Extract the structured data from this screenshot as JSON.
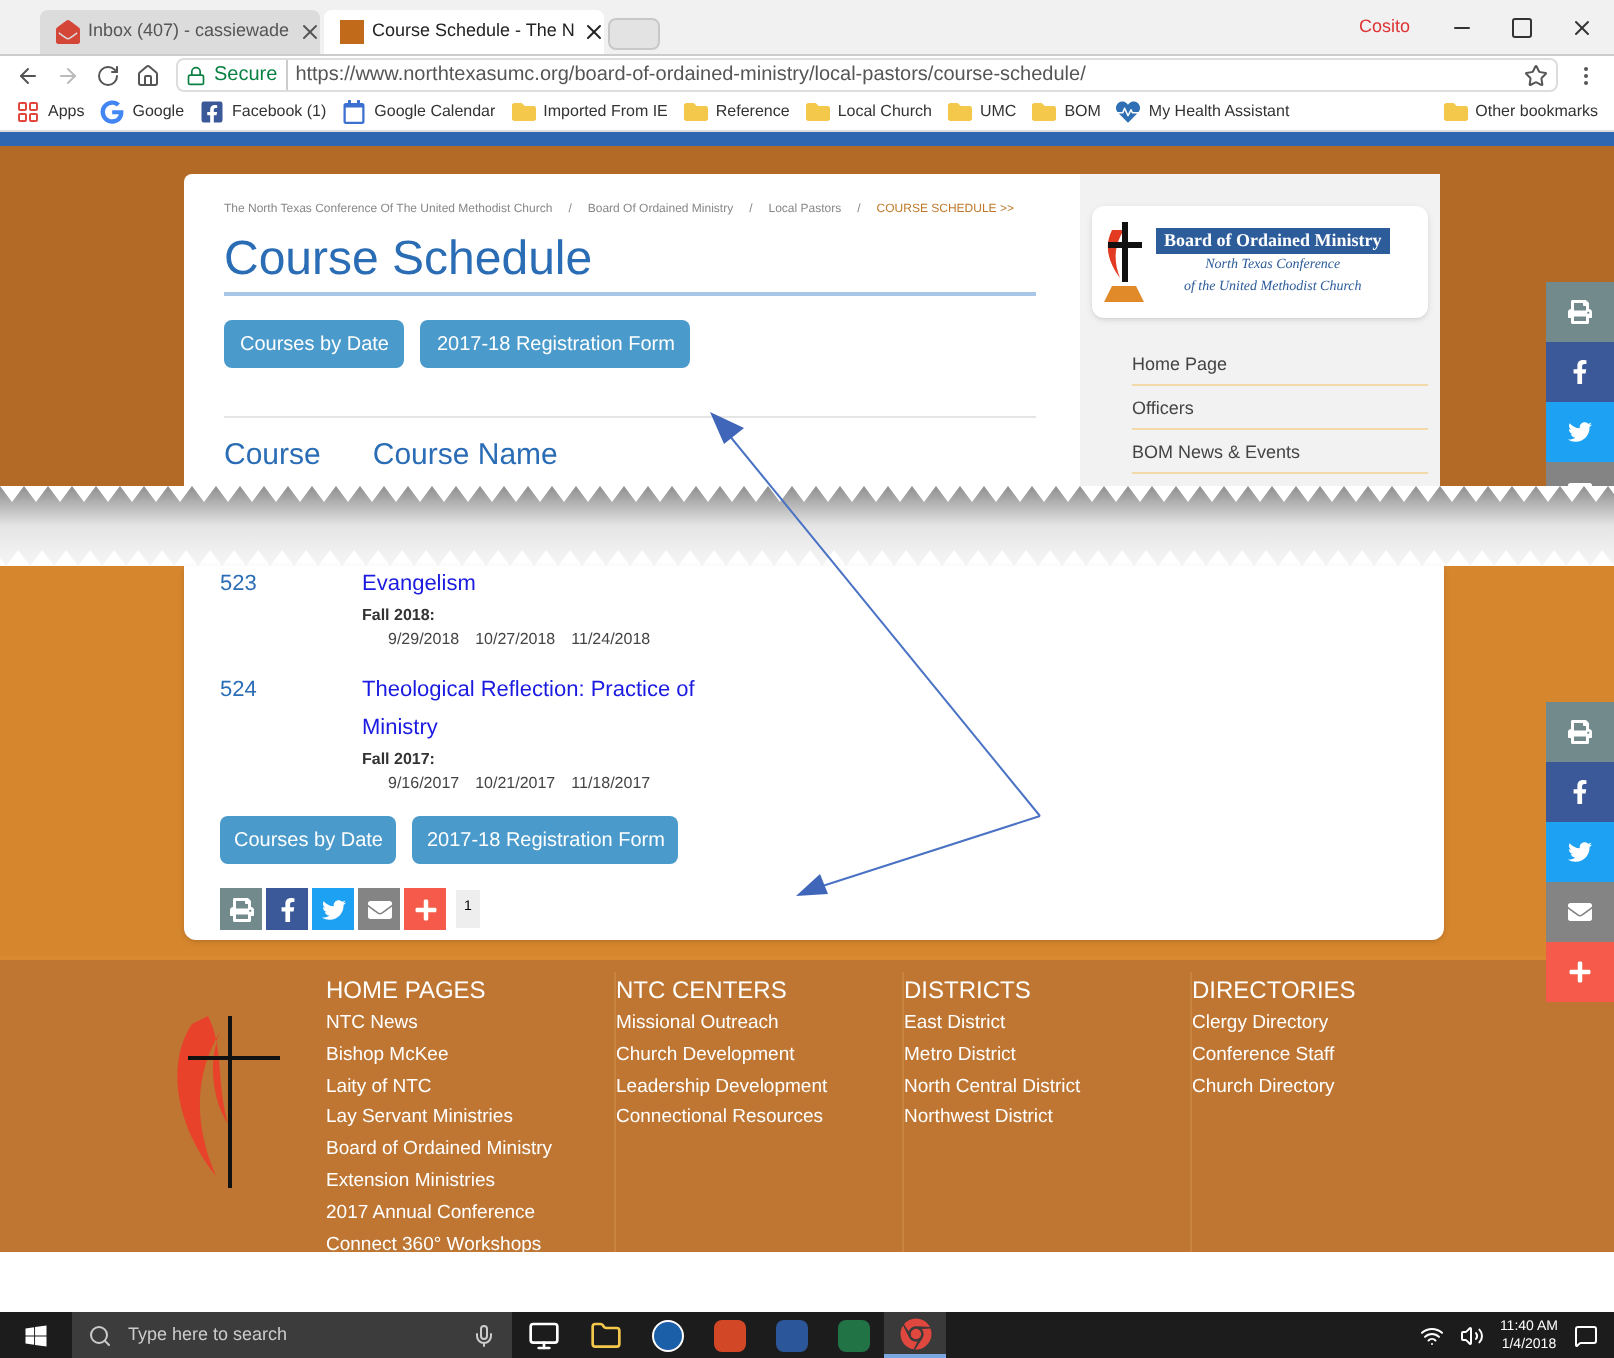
{
  "browser": {
    "tabs": [
      {
        "title": "Inbox (407) - cassiewade",
        "kind": "mail",
        "selected": false
      },
      {
        "title": "Course Schedule - The N",
        "kind": "site",
        "selected": true
      }
    ],
    "profile": "Cosito",
    "secure_label": "Secure",
    "url": "https://www.northtexasumc.org/board-of-ordained-ministry/local-pastors/course-schedule/",
    "bookmarks": [
      {
        "label": "Apps",
        "kind": "apps"
      },
      {
        "label": "Google",
        "kind": "google"
      },
      {
        "label": "Facebook (1)",
        "kind": "facebook"
      },
      {
        "label": "Google Calendar",
        "kind": "calendar"
      },
      {
        "label": "Imported From IE",
        "kind": "folder"
      },
      {
        "label": "Reference",
        "kind": "folder"
      },
      {
        "label": "Local Church",
        "kind": "folder"
      },
      {
        "label": "UMC",
        "kind": "folder"
      },
      {
        "label": "BOM",
        "kind": "folder"
      },
      {
        "label": "My Health Assistant",
        "kind": "health"
      }
    ],
    "other_bookmarks": "Other bookmarks"
  },
  "breadcrumbs": [
    "The North Texas Conference Of The United Methodist Church",
    "Board Of Ordained Ministry",
    "Local Pastors"
  ],
  "breadcrumb_separator": "/",
  "current_crumb": "COURSE SCHEDULE >>",
  "title": "Course Schedule",
  "top_buttons": [
    "Courses by Date",
    "2017-18 Registration Form"
  ],
  "table_headings": [
    "Course",
    "Course Name"
  ],
  "logo": {
    "title": "Board of Ordained Ministry",
    "line_1": "North Texas Conference",
    "line_2": "of the United Methodist Church"
  },
  "side_nav": [
    "Home Page",
    "Officers",
    "BOM News & Events"
  ],
  "courses": [
    {
      "number": "523",
      "name": "Evangelism",
      "term": "Fall 2018:",
      "dates": [
        "9/29/2018",
        "10/27/2018",
        "11/24/2018"
      ]
    },
    {
      "number": "524",
      "name": "Theological Reflection: Practice of Ministry",
      "term": "Fall 2017:",
      "dates": [
        "9/16/2017",
        "10/21/2017",
        "11/18/2017"
      ]
    }
  ],
  "bottom_buttons": [
    "Courses by Date",
    "2017-18 Registration Form"
  ],
  "share_bar": [
    {
      "kind": "print"
    },
    {
      "kind": "facebook"
    },
    {
      "kind": "twitter"
    },
    {
      "kind": "email"
    },
    {
      "kind": "plus"
    }
  ],
  "share_count": "1",
  "side_share_top": [
    {
      "kind": "print"
    },
    {
      "kind": "facebook"
    },
    {
      "kind": "twitter"
    },
    {
      "kind": "email"
    }
  ],
  "side_share_bottom": [
    {
      "kind": "print"
    },
    {
      "kind": "facebook"
    },
    {
      "kind": "twitter"
    },
    {
      "kind": "email"
    },
    {
      "kind": "plus"
    }
  ],
  "footer": [
    {
      "heading": "HOME PAGES",
      "links": [
        "NTC News",
        "Bishop McKee",
        "Laity of NTC",
        "Lay Servant Ministries",
        "Board of Ordained Ministry",
        "Extension Ministries",
        "2017 Annual Conference",
        "Connect 360° Workshops"
      ]
    },
    {
      "heading": "NTC CENTERS",
      "links": [
        "Missional Outreach",
        "Church Development",
        "Leadership Development",
        "Connectional Resources"
      ]
    },
    {
      "heading": "DISTRICTS",
      "links": [
        "East District",
        "Metro District",
        "North Central District",
        "Northwest District"
      ]
    },
    {
      "heading": "DIRECTORIES",
      "links": [
        "Clergy Directory",
        "Conference Staff",
        "Church Directory"
      ]
    }
  ],
  "taskbar": {
    "search_placeholder": "Type here to search",
    "apps": [
      {
        "kind": "taskview",
        "selected": false
      },
      {
        "kind": "explorer",
        "selected": false
      },
      {
        "kind": "hp",
        "selected": false
      },
      {
        "kind": "powerpoint",
        "selected": false
      },
      {
        "kind": "word",
        "selected": false
      },
      {
        "kind": "excel",
        "selected": false
      },
      {
        "kind": "chrome",
        "selected": true
      }
    ],
    "time": "11:40 AM",
    "date": "1/4/2018"
  }
}
